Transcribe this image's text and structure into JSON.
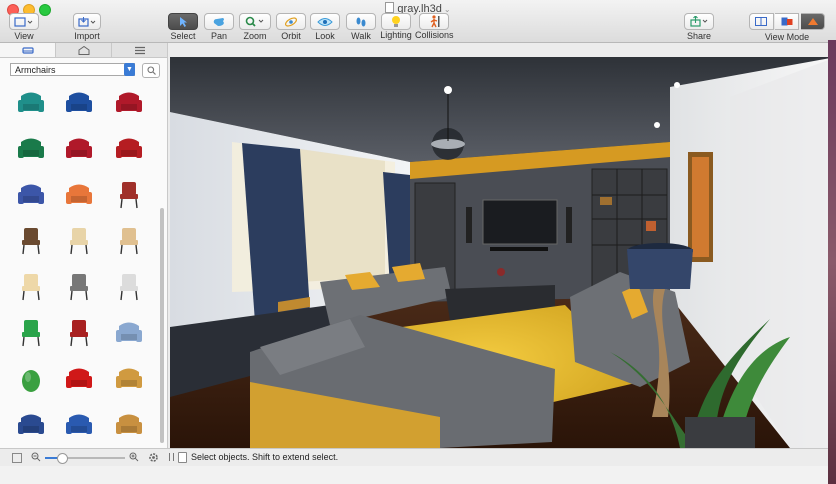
{
  "window": {
    "title": "gray.lh3d"
  },
  "toolbar": {
    "view": "View",
    "import": "Import",
    "select": "Select",
    "pan": "Pan",
    "zoom": "Zoom",
    "orbit": "Orbit",
    "look": "Look",
    "walk": "Walk",
    "lighting": "Lighting",
    "collisions": "Collisions",
    "share": "Share",
    "view_mode": "View Mode"
  },
  "sidebar": {
    "category": "Armchairs",
    "items": [
      {
        "icon": "armchair-teal",
        "color": "#1f8f8a"
      },
      {
        "icon": "armchair-blue",
        "color": "#1e4fa0"
      },
      {
        "icon": "armchair-red",
        "color": "#b0192a"
      },
      {
        "icon": "armchair-green",
        "color": "#1a7a4a"
      },
      {
        "icon": "armchair-red",
        "color": "#b0192a"
      },
      {
        "icon": "armchair-red",
        "color": "#b51d22"
      },
      {
        "icon": "armchair-navy",
        "color": "#3c56a8"
      },
      {
        "icon": "armchair-orange",
        "color": "#e8763a"
      },
      {
        "icon": "chair-red",
        "color": "#a0302a"
      },
      {
        "icon": "chair-wood",
        "color": "#6a4a30"
      },
      {
        "icon": "chair-beige",
        "color": "#e8d4a8"
      },
      {
        "icon": "chair-beige",
        "color": "#e0c090"
      },
      {
        "icon": "chair-beige",
        "color": "#eed8a8"
      },
      {
        "icon": "office-chair-gray",
        "color": "#777777"
      },
      {
        "icon": "chair-white",
        "color": "#dcdcdc"
      },
      {
        "icon": "chair-green",
        "color": "#2aa44a"
      },
      {
        "icon": "chair-red",
        "color": "#a82020"
      },
      {
        "icon": "armchair-lightblue",
        "color": "#8aa8d0"
      },
      {
        "icon": "beanbag-green",
        "color": "#3aa040"
      },
      {
        "icon": "armchair-red",
        "color": "#d01818"
      },
      {
        "icon": "armchair-tan",
        "color": "#d09a40"
      },
      {
        "icon": "armchair-navy",
        "color": "#2a4a90"
      },
      {
        "icon": "armchair-blue",
        "color": "#2a5ab0"
      },
      {
        "icon": "armchair-tan",
        "color": "#c89040"
      }
    ]
  },
  "status": {
    "text": "Select objects. Shift to extend select."
  }
}
